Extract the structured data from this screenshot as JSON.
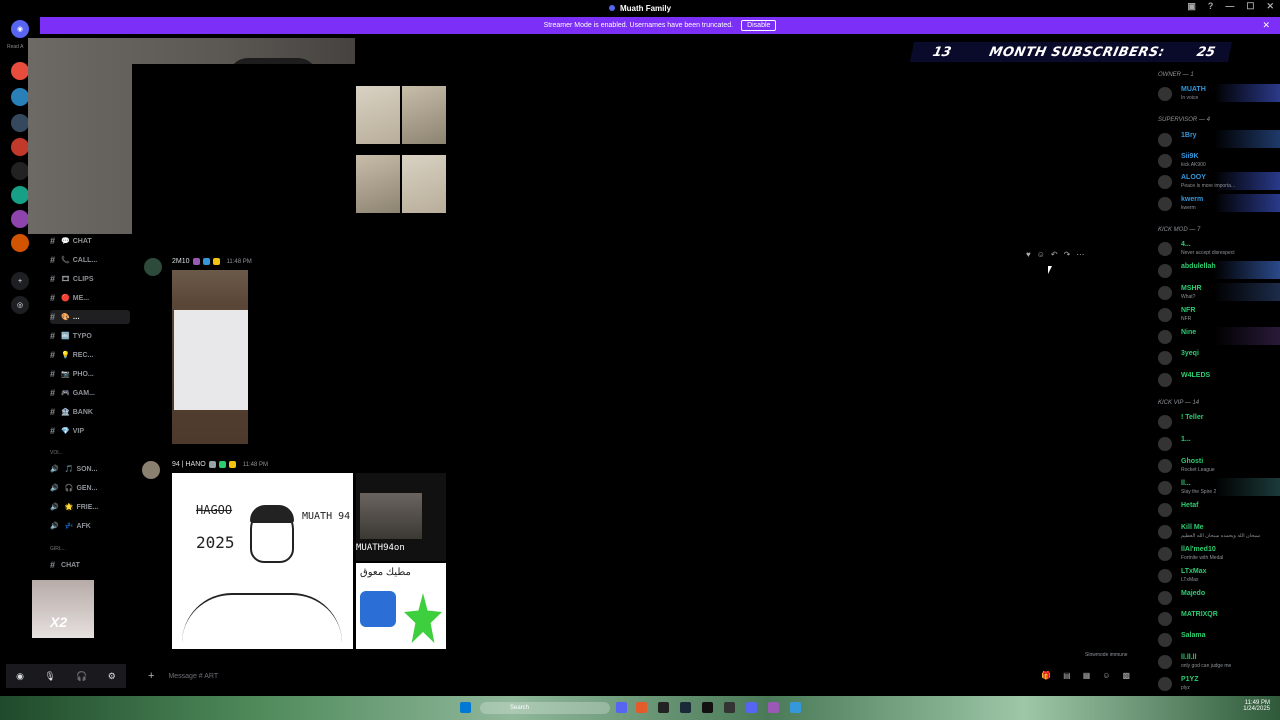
{
  "window": {
    "title": "Muath Family"
  },
  "banner": {
    "text": "Streamer Mode is enabled. Usernames have been truncated.",
    "disable_label": "Disable"
  },
  "rail": {
    "read_all": "Read A"
  },
  "subcounter": {
    "count": "13",
    "label": "MONTH SUBSCRIBERS:",
    "goal": "25"
  },
  "channels": [
    {
      "name": "CHAT",
      "emoji": "💬",
      "active": false
    },
    {
      "name": "CALL...",
      "emoji": "📞",
      "active": false
    },
    {
      "name": "CLIPS",
      "emoji": "🎞",
      "active": false
    },
    {
      "name": "ME...",
      "emoji": "🔴",
      "active": false
    },
    {
      "name": "…",
      "emoji": "🎨",
      "active": true
    },
    {
      "name": "TYPO",
      "emoji": "🔤",
      "active": false
    },
    {
      "name": "REC...",
      "emoji": "💡",
      "active": false
    },
    {
      "name": "PHO...",
      "emoji": "📷",
      "active": false
    },
    {
      "name": "GAM...",
      "emoji": "🎮",
      "active": false
    },
    {
      "name": "BANK",
      "emoji": "🏦",
      "active": false
    },
    {
      "name": "VIP",
      "emoji": "💎",
      "active": false
    }
  ],
  "voice_category": "VOI...",
  "voice_channels": [
    {
      "name": "SON...",
      "emoji": "🎵"
    },
    {
      "name": "GEN...",
      "emoji": "🎧"
    },
    {
      "name": "FRIE...",
      "emoji": "🌟"
    },
    {
      "name": "AFK",
      "emoji": "💤"
    }
  ],
  "girl_category": "GIRL...",
  "girl_channel": "CHAT",
  "messages": [
    {
      "author": "2M10",
      "time": "11:48 PM"
    },
    {
      "author": "94 | HANO",
      "time": "11:48 PM"
    }
  ],
  "sketch_text": {
    "name": "HAGOO",
    "year": "2025",
    "muath": "MUATH 94",
    "muath2": "MUATH94on",
    "arabic": "مطيك معوق"
  },
  "composer": {
    "placeholder": "Message # ART",
    "slowmode": "Slowmode immune"
  },
  "members": {
    "roles": [
      {
        "label": "OWNER — 1"
      },
      {
        "label": "SUPERVISOR — 4"
      },
      {
        "label": "KICK MOD — 7"
      },
      {
        "label": "KICK VIP — 14"
      }
    ],
    "list": [
      {
        "name": "MUATH",
        "status": "In voice",
        "color": "#3498db"
      },
      {
        "name": "1Bry",
        "status": "",
        "color": "#3498db"
      },
      {
        "name": "Sii9K",
        "status": "kick AK900",
        "color": "#3498db"
      },
      {
        "name": "ALOOY",
        "status": "Peace is more importa...",
        "color": "#3498db"
      },
      {
        "name": "kwerm",
        "status": "kwerm",
        "color": "#3498db"
      },
      {
        "name": "4...",
        "status": "Never accept disrespect",
        "color": "#2ecc71"
      },
      {
        "name": "abdulellah",
        "status": "",
        "color": "#2ecc71"
      },
      {
        "name": "MSHR",
        "status": "What?",
        "color": "#2ecc71"
      },
      {
        "name": "NFR",
        "status": "NFR",
        "color": "#2ecc71"
      },
      {
        "name": "Nine",
        "status": "",
        "color": "#2ecc71"
      },
      {
        "name": "3yeqi",
        "status": "",
        "color": "#2ecc71"
      },
      {
        "name": "W4LEDS",
        "status": "",
        "color": "#2ecc71"
      },
      {
        "name": "! Teller",
        "status": "",
        "color": "#2ecc71"
      },
      {
        "name": "1...",
        "status": "",
        "color": "#2ecc71"
      },
      {
        "name": "Ghosti",
        "status": "Rocket League",
        "color": "#2ecc71"
      },
      {
        "name": "ll...",
        "status": "Slay the Spire 2",
        "color": "#2ecc71"
      },
      {
        "name": "Hetaf",
        "status": "",
        "color": "#2ecc71"
      },
      {
        "name": "Kill Me",
        "status": "سبحان الله وبحمده سبحان الله العظيم",
        "color": "#2ecc71"
      },
      {
        "name": "llAl'med10",
        "status": "Fortnite with Medal",
        "color": "#2ecc71"
      },
      {
        "name": "LTxMax",
        "status": "LTxMax",
        "color": "#2ecc71"
      },
      {
        "name": "Majedo",
        "status": "",
        "color": "#2ecc71"
      },
      {
        "name": "MATRIXQR",
        "status": "",
        "color": "#2ecc71"
      },
      {
        "name": "Salama",
        "status": "",
        "color": "#2ecc71"
      },
      {
        "name": "ll.ll.ll",
        "status": "only god can judge me",
        "color": "#2ecc71"
      },
      {
        "name": "P1YZ",
        "status": "plyz",
        "color": "#2ecc71"
      }
    ]
  },
  "taskbar": {
    "search": "Search",
    "time": "11:49 PM",
    "date": "1/24/2025"
  }
}
